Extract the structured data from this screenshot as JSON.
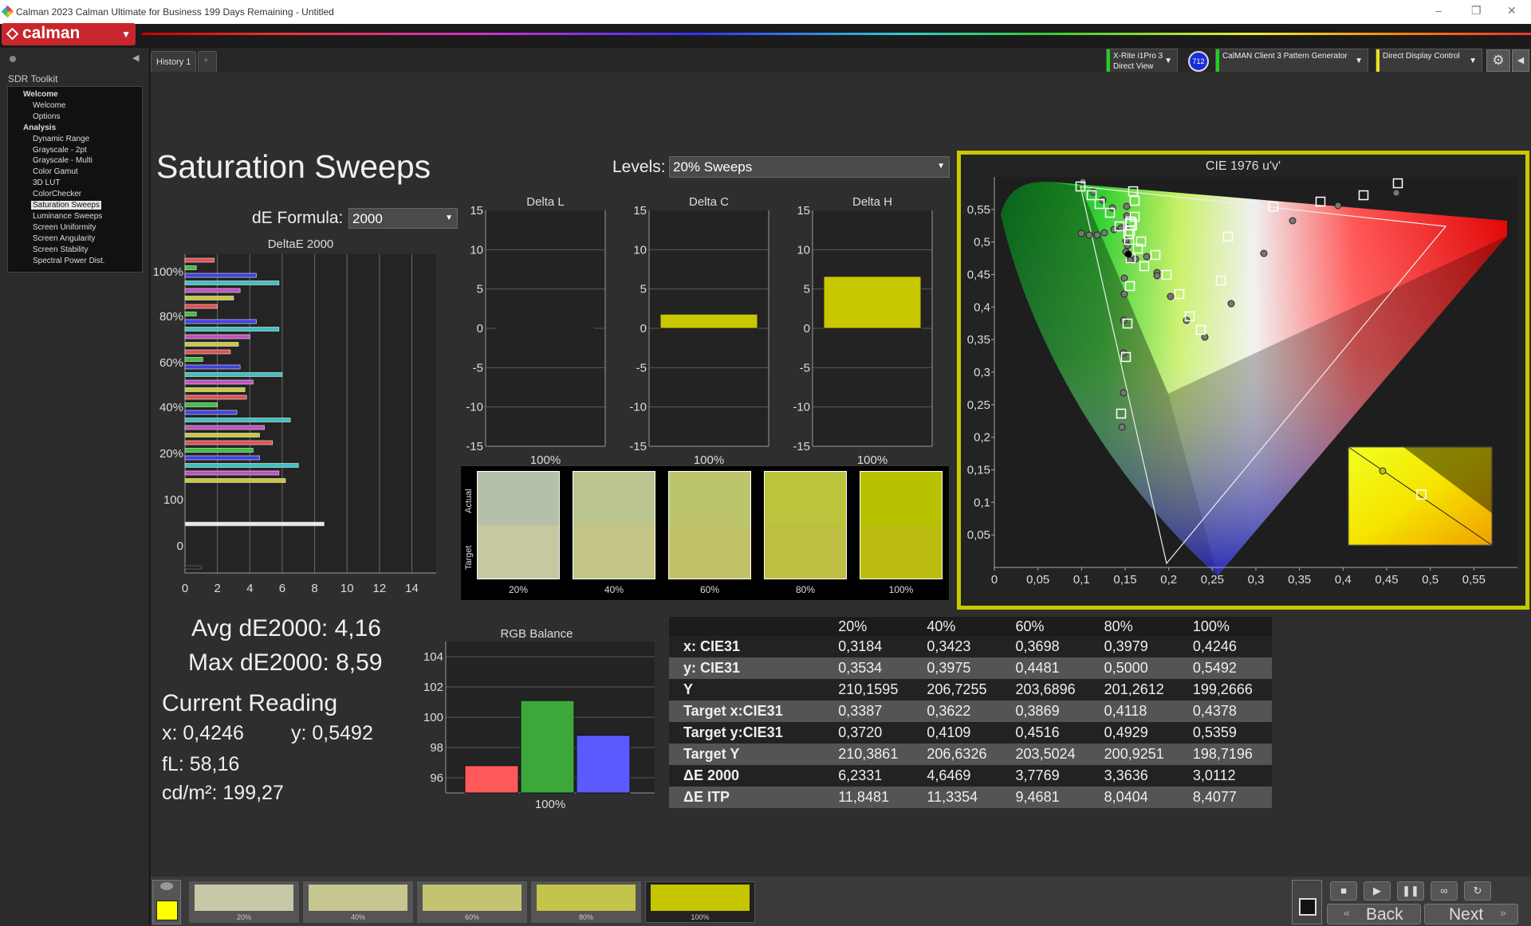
{
  "window": {
    "title": "Calman 2023 Calman Ultimate for Business 199 Days Remaining  - Untitled",
    "controls": [
      "–",
      "❐",
      "✕"
    ]
  },
  "brand": {
    "logo_text": "calman",
    "accent": "#c8262c"
  },
  "sidebar": {
    "header": "SDR Toolkit",
    "tree": [
      {
        "label": "Welcome",
        "type": "group"
      },
      {
        "label": "Welcome",
        "type": "leaf"
      },
      {
        "label": "Options",
        "type": "leaf"
      },
      {
        "label": "Analysis",
        "type": "group"
      },
      {
        "label": "Dynamic Range",
        "type": "leaf"
      },
      {
        "label": "Grayscale - 2pt",
        "type": "leaf"
      },
      {
        "label": "Grayscale - Multi",
        "type": "leaf"
      },
      {
        "label": "Color Gamut",
        "type": "leaf"
      },
      {
        "label": "3D LUT",
        "type": "leaf"
      },
      {
        "label": "ColorChecker",
        "type": "leaf"
      },
      {
        "label": "Saturation Sweeps",
        "type": "selected"
      },
      {
        "label": "Luminance Sweeps",
        "type": "leaf"
      },
      {
        "label": "Screen Uniformity",
        "type": "leaf"
      },
      {
        "label": "Screen Angularity",
        "type": "leaf"
      },
      {
        "label": "Screen Stability",
        "type": "leaf"
      },
      {
        "label": "Spectral Power Dist.",
        "type": "leaf"
      }
    ]
  },
  "tabs": {
    "history": "History 1",
    "add": "+"
  },
  "devices": {
    "meter_line1": "X-Rite i1Pro 3",
    "meter_line2": "Direct View",
    "meter_badge": "712",
    "generator": "CalMAN Client 3 Pattern Generator",
    "display": "Direct Display Control"
  },
  "page": {
    "title": "Saturation Sweeps",
    "levels_label": "Levels:",
    "levels_value": "20% Sweeps",
    "formula_label": "dE Formula:",
    "formula_value": "2000"
  },
  "deltae_chart": {
    "title": "DeltaE 2000",
    "y_labels": [
      "100%",
      "80%",
      "60%",
      "40%",
      "20%",
      "100",
      "0"
    ],
    "x_ticks": [
      "0",
      "2",
      "4",
      "6",
      "8",
      "10",
      "12",
      "14"
    ]
  },
  "delta_charts": [
    {
      "title": "Delta L",
      "value": 0.0,
      "color": "#c8c800"
    },
    {
      "title": "Delta C",
      "value": 1.8,
      "color": "#c8c800"
    },
    {
      "title": "Delta H",
      "value": 6.6,
      "color": "#c8c800"
    }
  ],
  "delta_ticks": [
    "15",
    "10",
    "5",
    "0",
    "-5",
    "-10",
    "-15"
  ],
  "delta_xlabel": "100%",
  "swatch_compare": {
    "actual_label": "Actual",
    "target_label": "Target",
    "items": [
      {
        "label": "20%",
        "actual": "#b5c0a9",
        "target": "#c8c8a0"
      },
      {
        "label": "40%",
        "actual": "#b9c48e",
        "target": "#c4c486"
      },
      {
        "label": "60%",
        "actual": "#bcc56c",
        "target": "#c1c16a"
      },
      {
        "label": "80%",
        "actual": "#bcc43c",
        "target": "#bebe42"
      },
      {
        "label": "100%",
        "actual": "#b9c200",
        "target": "#bcbc10"
      }
    ]
  },
  "cie": {
    "title": "CIE 1976 u'v'",
    "x_ticks": [
      "0",
      "0,05",
      "0,1",
      "0,15",
      "0,2",
      "0,25",
      "0,3",
      "0,35",
      "0,4",
      "0,45",
      "0,5",
      "0,55"
    ],
    "y_ticks": [
      "0,55",
      "0,5",
      "0,45",
      "0,4",
      "0,35",
      "0,3",
      "0,25",
      "0,2",
      "0,15",
      "0,1",
      "0,05"
    ]
  },
  "stats": {
    "avg": "Avg dE2000: 4,16",
    "max": "Max dE2000: 8,59",
    "current_reading": "Current Reading",
    "x": "x: 0,4246",
    "y": "y: 0,5492",
    "fl": "fL: 58,16",
    "cdm2": "cd/m²: 199,27"
  },
  "rgb_balance": {
    "title": "RGB Balance",
    "xlabel": "100%",
    "y_ticks": [
      "104",
      "102",
      "100",
      "98",
      "96"
    ],
    "ylim": [
      95,
      105
    ],
    "values": {
      "red": 96.8,
      "green": 101.1,
      "blue": 98.8
    }
  },
  "table": {
    "headers": [
      "",
      "20%",
      "40%",
      "60%",
      "80%",
      "100%"
    ],
    "rows": [
      [
        "x: CIE31",
        "0,3184",
        "0,3423",
        "0,3698",
        "0,3979",
        "0,4246"
      ],
      [
        "y: CIE31",
        "0,3534",
        "0,3975",
        "0,4481",
        "0,5000",
        "0,5492"
      ],
      [
        "Y",
        "210,1595",
        "206,7255",
        "203,6896",
        "201,2612",
        "199,2666"
      ],
      [
        "Target x:CIE31",
        "0,3387",
        "0,3622",
        "0,3869",
        "0,4118",
        "0,4378"
      ],
      [
        "Target y:CIE31",
        "0,3720",
        "0,4109",
        "0,4516",
        "0,4929",
        "0,5359"
      ],
      [
        "Target Y",
        "210,3861",
        "206,6326",
        "203,5024",
        "200,9251",
        "198,7196"
      ],
      [
        "ΔE 2000",
        "6,2331",
        "4,6469",
        "3,7769",
        "3,3636",
        "3,0112"
      ],
      [
        "ΔE ITP",
        "11,8481",
        "11,3354",
        "9,4681",
        "8,0404",
        "8,4077"
      ]
    ]
  },
  "bottom_swatches": [
    {
      "label": "20%",
      "color": "#c7c8a8"
    },
    {
      "label": "40%",
      "color": "#c6c690"
    },
    {
      "label": "60%",
      "color": "#c4c470"
    },
    {
      "label": "80%",
      "color": "#c4c44a"
    },
    {
      "label": "100%",
      "color": "#c6c600"
    }
  ],
  "nav": {
    "back": "Back",
    "next": "Next"
  }
}
